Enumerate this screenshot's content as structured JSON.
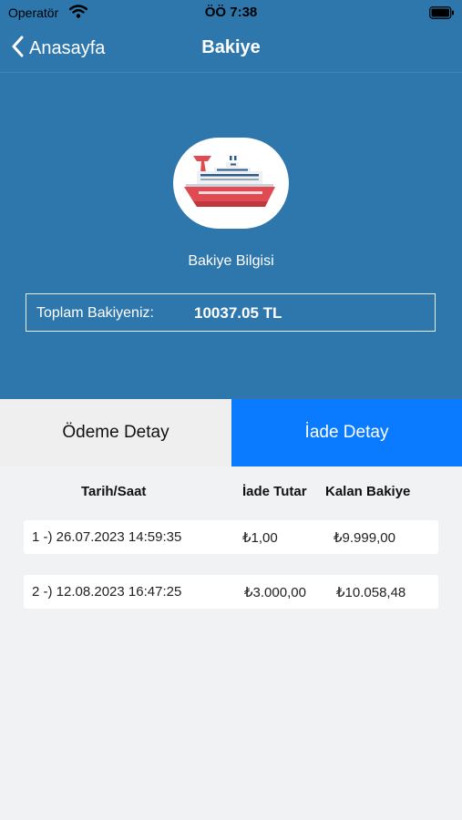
{
  "status_bar": {
    "carrier": "Operatör",
    "time": "ÖÖ 7:38"
  },
  "nav": {
    "back_label": "Anasayfa",
    "title": "Bakiye"
  },
  "balance": {
    "caption": "Bakiye Bilgisi",
    "label": "Toplam Bakiyeniz:",
    "value": "10037.05 TL"
  },
  "tabs": [
    {
      "label": "Ödeme Detay",
      "selected": false
    },
    {
      "label": "İade Detay",
      "selected": true
    }
  ],
  "table": {
    "columns": [
      "Tarih/Saat",
      "İade Tutar",
      "Kalan Bakiye"
    ],
    "rows": [
      {
        "date": "1 -) 26.07.2023 14:59:35",
        "amount": "₺1,00",
        "remaining": "₺9.999,00"
      },
      {
        "date": "2 -) 12.08.2023 16:47:25",
        "amount": "₺3.000,00",
        "remaining": "₺10.058,48"
      }
    ]
  },
  "colors": {
    "header_bg": "#2d77ad",
    "active_tab": "#0a7bff",
    "page_bg": "#f1f2f3"
  },
  "icons": {
    "logo": "ship-icon",
    "back": "chevron-left-icon",
    "wifi": "wifi-icon",
    "battery": "battery-icon"
  }
}
